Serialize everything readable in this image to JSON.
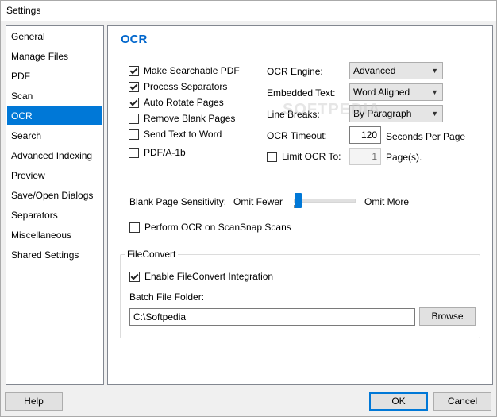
{
  "window": {
    "title": "Settings"
  },
  "sidebar": {
    "items": [
      {
        "label": "General"
      },
      {
        "label": "Manage Files"
      },
      {
        "label": "PDF"
      },
      {
        "label": "Scan"
      },
      {
        "label": "OCR"
      },
      {
        "label": "Search"
      },
      {
        "label": "Advanced Indexing"
      },
      {
        "label": "Preview"
      },
      {
        "label": "Save/Open Dialogs"
      },
      {
        "label": "Separators"
      },
      {
        "label": "Miscellaneous"
      },
      {
        "label": "Shared Settings"
      }
    ],
    "selected": "OCR"
  },
  "ocr": {
    "heading": "OCR",
    "options": {
      "make_searchable": {
        "label": "Make Searchable PDF",
        "checked": true
      },
      "process_separators": {
        "label": "Process Separators",
        "checked": true
      },
      "auto_rotate": {
        "label": "Auto Rotate Pages",
        "checked": true
      },
      "remove_blank": {
        "label": "Remove Blank Pages",
        "checked": false
      },
      "send_text_word": {
        "label": "Send Text to Word",
        "checked": false
      },
      "pdfa": {
        "label": "PDF/A-1b",
        "checked": false
      }
    },
    "engine": {
      "label": "OCR Engine:",
      "value": "Advanced"
    },
    "embedded_text": {
      "label": "Embedded Text:",
      "value": "Word Aligned"
    },
    "line_breaks": {
      "label": "Line Breaks:",
      "value": "By Paragraph"
    },
    "timeout": {
      "label": "OCR Timeout:",
      "value": "120",
      "unit": "Seconds Per Page"
    },
    "limit": {
      "label": "Limit OCR To:",
      "checked": false,
      "value": "1",
      "unit": "Page(s)."
    },
    "blank_sensitivity": {
      "label": "Blank Page Sensitivity:",
      "min_label": "Omit Fewer",
      "max_label": "Omit More",
      "level": 0.02
    },
    "scansnap": {
      "label": "Perform OCR on ScanSnap Scans",
      "checked": false
    }
  },
  "fileconvert": {
    "group_title": "FileConvert",
    "enable": {
      "label": "Enable FileConvert Integration",
      "checked": true
    },
    "batch_label": "Batch File Folder:",
    "batch_value": "C:\\Softpedia",
    "browse_label": "Browse"
  },
  "footer": {
    "help_label": "Help",
    "ok_label": "OK",
    "cancel_label": "Cancel"
  },
  "watermark": "SOFTPEDIA",
  "colors": {
    "accent": "#0078d7",
    "heading": "#0066cc"
  }
}
